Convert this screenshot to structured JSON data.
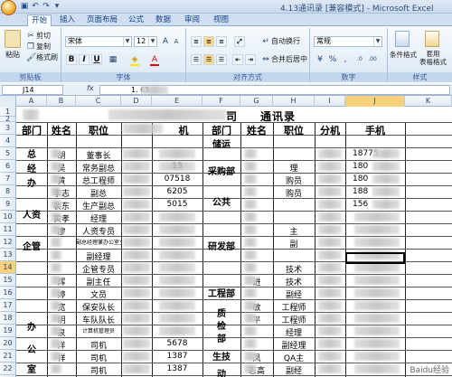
{
  "window": {
    "title": "4.13通讯录 [兼容模式] - Microsoft Excel"
  },
  "tabs": [
    "开始",
    "插入",
    "页面布局",
    "公式",
    "数据",
    "审阅",
    "视图"
  ],
  "ribbon": {
    "paste": "粘贴",
    "cut": "剪切",
    "copy": "复制",
    "format_painter": "格式刷",
    "font_name": "宋体",
    "font_size": "12",
    "wrap_text": "自动换行",
    "merge_center": "合并后居中",
    "number_format": "常规",
    "conditional_format": "条件格式",
    "format_as_table": "套用\n表格格式",
    "groups": [
      "剪贴板",
      "字体",
      "对齐方式",
      "数字",
      "样式"
    ],
    "bold": "B",
    "italic": "I",
    "underline": "U"
  },
  "formula_bar": {
    "name_box": "J14",
    "fx": "fx",
    "content": "1.  65"
  },
  "columns": [
    "A",
    "B",
    "C",
    "D",
    "E",
    "F",
    "G",
    "H",
    "I",
    "J",
    "K"
  ],
  "rows": [
    "1",
    "2",
    "3",
    "4",
    "5",
    "6",
    "7",
    "8",
    "9",
    "10",
    "11",
    "12",
    "13",
    "14",
    "15",
    "16",
    "17",
    "18",
    "19",
    "20",
    "21",
    "22",
    "23",
    "24",
    "25"
  ],
  "sheet": {
    "title_left": "司",
    "title_right": "通讯录",
    "header": {
      "dept": "部门",
      "name": "姓名",
      "position": "职位",
      "phone_partial": "机",
      "dept2": "部门",
      "name2": "姓名",
      "position2": "职位",
      "ext": "分机",
      "mobile": "手机"
    },
    "left_depts": {
      "gm_office_1": "总",
      "gm_office_2": "经",
      "gm_office_3": "办",
      "hr": "人资",
      "corp": "企管",
      "office_1": "办",
      "office_2": "公",
      "office_3": "室"
    },
    "left_rows": [
      {
        "name": "胡",
        "position": "董事长"
      },
      {
        "name": "吴",
        "position": "常务副总"
      },
      {
        "name": "黄",
        "position": "总工程师"
      },
      {
        "name": "李志",
        "position": "副总"
      },
      {
        "name": "裴东",
        "position": "生产副总"
      },
      {
        "name": "黄孝",
        "position": "经理"
      },
      {
        "name": "廖",
        "position": "人资专员"
      },
      {
        "name": "",
        "position": "副总经理兼办公室主任"
      },
      {
        "name": "",
        "position": "副经理"
      },
      {
        "name": "",
        "position": "企管专员"
      },
      {
        "name": "辉",
        "position": "副主任"
      },
      {
        "name": "婷",
        "position": "文员"
      },
      {
        "name": "宽",
        "position": "保安队长"
      },
      {
        "name": "明",
        "position": "车队队长"
      },
      {
        "name": "泉",
        "position": "计算机管理员"
      },
      {
        "name": "洋",
        "position": "司机"
      },
      {
        "name": "祥",
        "position": "司机"
      },
      {
        "name": "",
        "position": "司机"
      },
      {
        "name": "",
        "position": "司机"
      }
    ],
    "left_phones": [
      "",
      "13",
      "07518",
      "6205",
      "5015",
      "",
      "",
      "",
      "",
      "",
      "",
      "",
      "",
      "",
      "",
      "5678",
      "1387",
      "1387",
      ""
    ],
    "right_depts": {
      "digital": "储运",
      "purchase": "采购部",
      "public": "公共",
      "rd": "研发部",
      "engineering": "工程部",
      "qa_1": "质",
      "qa_2": "检",
      "qa_3": "部",
      "production": "生技",
      "last": "动"
    },
    "right_rows": [
      {
        "name": "",
        "position": "",
        "ext": "",
        "mobile": "18775"
      },
      {
        "name": "",
        "position": "理",
        "ext": "",
        "mobile": "180"
      },
      {
        "name": "",
        "position": "购员",
        "ext": "",
        "mobile": "180"
      },
      {
        "name": "",
        "position": "购员",
        "ext": "",
        "mobile": "188"
      },
      {
        "name": "",
        "position": "",
        "ext": "",
        "mobile": "156"
      },
      {
        "name": "",
        "position": "",
        "ext": "",
        "mobile": ""
      },
      {
        "name": "",
        "position": "主",
        "ext": "",
        "mobile": ""
      },
      {
        "name": "",
        "position": "副",
        "ext": "",
        "mobile": ""
      },
      {
        "name": "",
        "position": "",
        "ext": "",
        "mobile": ""
      },
      {
        "name": "",
        "position": "技术",
        "ext": "",
        "mobile": ""
      },
      {
        "name": "进",
        "position": "技术",
        "ext": "",
        "mobile": ""
      },
      {
        "name": "",
        "position": "副经",
        "ext": "",
        "mobile": ""
      },
      {
        "name": "敏",
        "position": "工程师",
        "ext": "",
        "mobile": ""
      },
      {
        "name": "平",
        "position": "工程师",
        "ext": "",
        "mobile": ""
      },
      {
        "name": "",
        "position": "经理",
        "ext": "",
        "mobile": ""
      },
      {
        "name": "",
        "position": "副经理",
        "ext": "",
        "mobile": ""
      },
      {
        "name": "凤",
        "position": "QA主",
        "ext": "",
        "mobile": ""
      },
      {
        "name": "志高",
        "position": "副经",
        "ext": "",
        "mobile": ""
      },
      {
        "name": "柏",
        "position": "",
        "ext": "",
        "mobile": ""
      }
    ]
  },
  "watermark": "Baidu经验",
  "colors": {
    "selected_header": "#f7d27a",
    "ribbon_blue": "#dbe7f5",
    "title_text": "#344f7a"
  }
}
